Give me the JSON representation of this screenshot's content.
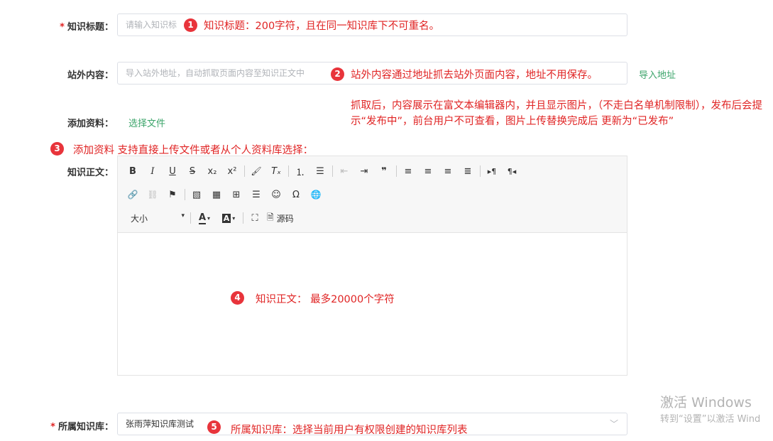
{
  "form": {
    "title": {
      "required_mark": "*",
      "label": "知识标题：",
      "placeholder": "请输入知识标",
      "note_num": "1",
      "note": "知识标题：200字符，且在同一知识库下不可重名。"
    },
    "external": {
      "label": "站外内容：",
      "placeholder": "导入站外地址，自动抓取页面内容至知识正文中",
      "import_link": "导入地址",
      "note_num": "2",
      "note": "站外内容通过地址抓去站外页面内容，地址不用保存。",
      "note_detail": "抓取后，内容展示在富文本编辑器内，并且显示图片，（不走白名单机制限制），发布后会提示“发布中”，前台用户不可查看，图片上传替换完成后 更新为“已发布”"
    },
    "attachment": {
      "label": "添加资料：",
      "choose_file": "选择文件",
      "note_num": "3",
      "note": "添加资料 支持直接上传文件或者从个人资料库选择："
    },
    "body": {
      "label": "知识正文：",
      "note_num": "4",
      "note": "知识正文：  最多20000个字符"
    },
    "library": {
      "required_mark": "*",
      "label": "所属知识库：",
      "value": "张雨萍知识库测试",
      "note_num": "5",
      "note": "所属知识库：选择当前用户有权限创建的知识库列表"
    }
  },
  "editor": {
    "row1": [
      {
        "name": "bold-icon",
        "glyph": "B",
        "style": "font-weight:bold"
      },
      {
        "name": "italic-icon",
        "glyph": "I",
        "style": "font-style:italic;font-family:'DejaVu Serif',serif"
      },
      {
        "name": "underline-icon",
        "glyph": "U",
        "style": "text-decoration:underline"
      },
      {
        "name": "strikethrough-icon",
        "glyph": "S",
        "style": "text-decoration:line-through"
      },
      {
        "name": "subscript-icon",
        "glyph": "x₂",
        "style": ""
      },
      {
        "name": "superscript-icon",
        "glyph": "x²",
        "style": ""
      },
      {
        "sep": true
      },
      {
        "name": "format-brush-icon",
        "glyph": "🖌",
        "style": "font-size:12px"
      },
      {
        "name": "clear-format-icon",
        "glyph": "Tₓ",
        "style": "font-style:italic"
      },
      {
        "sep": true
      },
      {
        "name": "ordered-list-icon",
        "glyph": "⒈",
        "style": ""
      },
      {
        "name": "bullet-list-icon",
        "glyph": "☰",
        "style": ""
      },
      {
        "sep": true
      },
      {
        "name": "outdent-icon",
        "glyph": "⇤",
        "style": "color:#bbb"
      },
      {
        "name": "indent-icon",
        "glyph": "⇥",
        "style": ""
      },
      {
        "name": "quote-icon",
        "glyph": "❞",
        "style": "font-weight:bold"
      },
      {
        "sep": true
      },
      {
        "name": "align-left-icon",
        "glyph": "≡",
        "style": ""
      },
      {
        "name": "align-center-icon",
        "glyph": "≡",
        "style": ""
      },
      {
        "name": "align-right-icon",
        "glyph": "≡",
        "style": ""
      },
      {
        "name": "justify-icon",
        "glyph": "≣",
        "style": ""
      },
      {
        "sep": true
      },
      {
        "name": "ltr-icon",
        "glyph": "▸¶",
        "style": "font-size:11px"
      },
      {
        "name": "rtl-icon",
        "glyph": "¶◂",
        "style": "font-size:11px"
      }
    ],
    "row2": [
      {
        "name": "link-icon",
        "glyph": "🔗",
        "style": "font-size:12px"
      },
      {
        "name": "unlink-icon",
        "glyph": "⛓",
        "style": "color:#bbb;font-size:12px"
      },
      {
        "name": "anchor-flag-icon",
        "glyph": "⚑",
        "style": ""
      },
      {
        "sep": true
      },
      {
        "name": "image-icon",
        "glyph": "▧",
        "style": ""
      },
      {
        "name": "media-icon",
        "glyph": "▦",
        "style": ""
      },
      {
        "name": "table-icon",
        "glyph": "⊞",
        "style": ""
      },
      {
        "name": "horizontal-rule-icon",
        "glyph": "☰",
        "style": ""
      },
      {
        "name": "emoji-icon",
        "glyph": "☺",
        "style": ""
      },
      {
        "name": "special-char-icon",
        "glyph": "Ω",
        "style": ""
      },
      {
        "name": "globe-icon",
        "glyph": "🌐",
        "style": "font-size:12px"
      }
    ],
    "font_size_label": "大小",
    "source_label": "源码"
  },
  "watermark": {
    "line1": "激活 Windows",
    "line2": "转到“设置”以激活 Wind"
  }
}
